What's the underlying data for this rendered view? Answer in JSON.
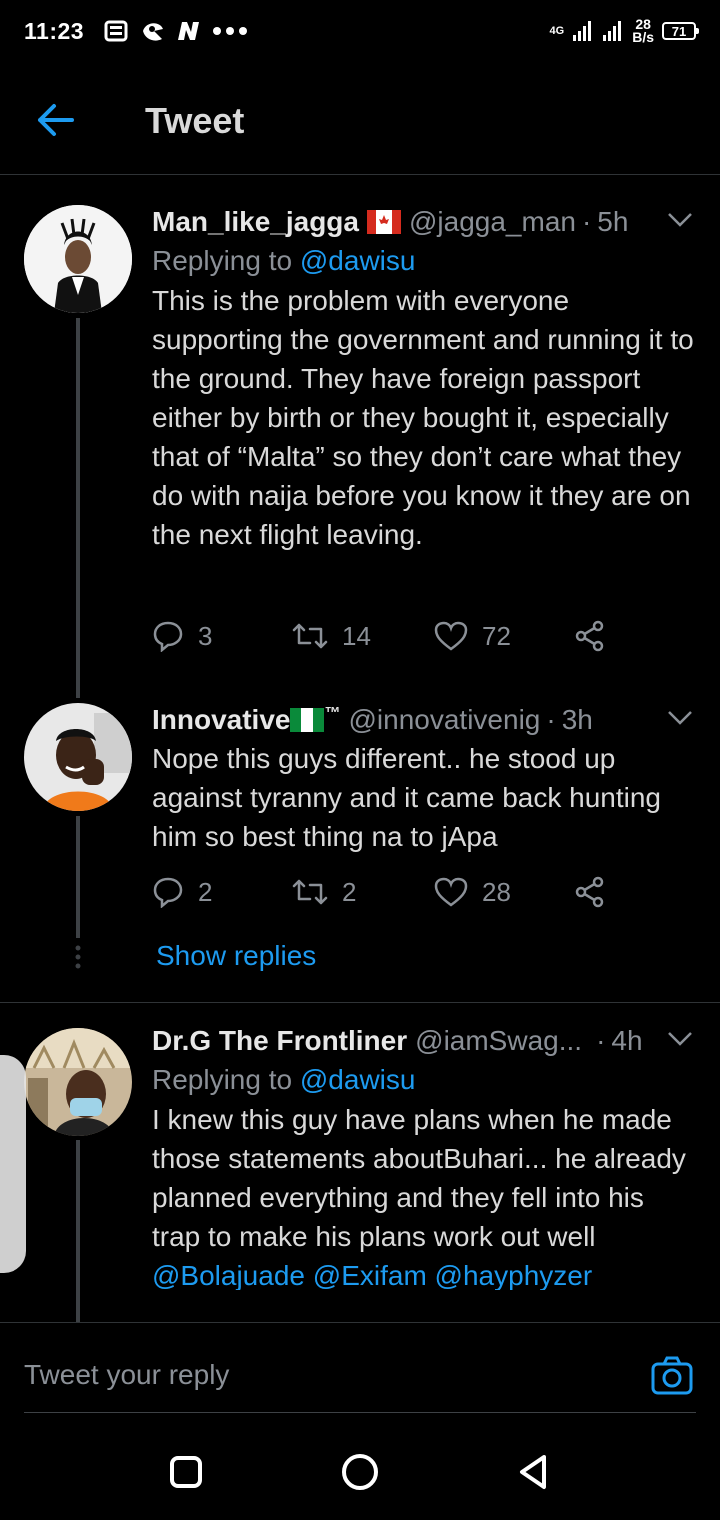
{
  "status_bar": {
    "time": "11:23",
    "network": "4G",
    "speed_value": "28",
    "speed_unit": "B/s",
    "battery": "71"
  },
  "header": {
    "title": "Tweet",
    "back_icon": "arrow-left-icon"
  },
  "tweets": [
    {
      "name": "Man_like_jagga",
      "flag": "canada-flag",
      "handle": "@jagga_man",
      "time": "5h",
      "replying_prefix": "Replying to ",
      "replying_to": "@dawisu",
      "text": "This is the problem with everyone supporting the government and running it to the ground. They have foreign passport either by birth or they bought it, especially that of “Malta” so they don’t care what they do with naija before you know it they are on the next flight leaving.",
      "replies": "3",
      "retweets": "14",
      "likes": "72"
    },
    {
      "name": "Innovative",
      "flag": "nigeria-flag",
      "name_suffix": "™",
      "handle": "@innovativenig",
      "time": "3h",
      "text": "Nope this guys different.. he stood up against tyranny and it came back hunting him so best thing na to jApa",
      "replies": "2",
      "retweets": "2",
      "likes": "28"
    },
    {
      "name": "Dr.G The Frontliner",
      "handle": "@iamSwag...",
      "time": "4h",
      "replying_prefix": "Replying to ",
      "replying_to": "@dawisu",
      "text": "I knew this guy have plans when he made those statements aboutBuhari... he already planned everything and they fell into his trap to make his plans work out well ",
      "mentions": [
        "@Bolajuade",
        "@Exifam",
        "@hayphyzer"
      ]
    }
  ],
  "show_replies": "Show replies",
  "reply_box": {
    "placeholder": "Tweet your reply",
    "camera_icon": "camera-icon"
  },
  "colors": {
    "accent": "#1d9bf0",
    "background": "#000000",
    "muted": "#8b9097"
  }
}
